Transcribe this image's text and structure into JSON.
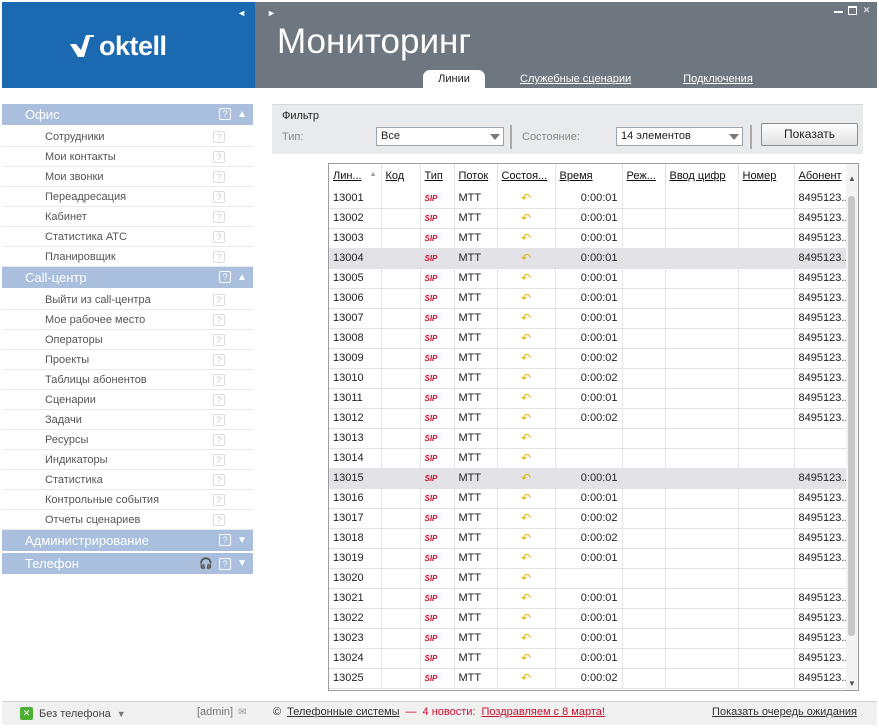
{
  "brand": {
    "name": "oktell"
  },
  "header": {
    "title": "Мониторинг",
    "tabs": [
      {
        "label": "Линии",
        "active": true
      },
      {
        "label": "Служебные сценарии",
        "active": false
      },
      {
        "label": "Подключения",
        "active": false
      }
    ]
  },
  "sidebar": {
    "sections": [
      {
        "label": "Офис",
        "expanded": true,
        "items": [
          "Сотрудники",
          "Мои контакты",
          "Мои звонки",
          "Переадресация",
          "Кабинет",
          "Статистика АТС",
          "Планировщик"
        ]
      },
      {
        "label": "Call-центр",
        "expanded": true,
        "items": [
          "Выйти из call-центра",
          "Мое рабочее место",
          "Операторы",
          "Проекты",
          "Таблицы абонентов",
          "Сценарии",
          "Задачи",
          "Ресурсы",
          "Индикаторы",
          "Статистика",
          "Контрольные события",
          "Отчеты сценариев"
        ]
      },
      {
        "label": "Администрирование",
        "expanded": false,
        "items": []
      },
      {
        "label": "Телефон",
        "expanded": false,
        "items": []
      }
    ]
  },
  "filter": {
    "title": "Фильтр",
    "type_label": "Тип:",
    "type_value": "Все",
    "state_label": "Состояние:",
    "state_value": "14 элементов",
    "show_button": "Показать"
  },
  "table": {
    "columns": [
      "Лин...",
      "Код",
      "Тип",
      "Поток",
      "Состоя...",
      "Время",
      "Реж...",
      "Ввод цифр",
      "Номер",
      "Абонент"
    ],
    "rows": [
      {
        "line": "13001",
        "type": "SIP",
        "stream": "MTT",
        "time": "0:00:01",
        "subscriber": "8495123..."
      },
      {
        "line": "13002",
        "type": "SIP",
        "stream": "MTT",
        "time": "0:00:01",
        "subscriber": "8495123..."
      },
      {
        "line": "13003",
        "type": "SIP",
        "stream": "MTT",
        "time": "0:00:01",
        "subscriber": "8495123..."
      },
      {
        "line": "13004",
        "type": "SIP",
        "stream": "MTT",
        "time": "0:00:01",
        "subscriber": "8495123...",
        "selected": true
      },
      {
        "line": "13005",
        "type": "SIP",
        "stream": "MTT",
        "time": "0:00:01",
        "subscriber": "8495123..."
      },
      {
        "line": "13006",
        "type": "SIP",
        "stream": "MTT",
        "time": "0:00:01",
        "subscriber": "8495123..."
      },
      {
        "line": "13007",
        "type": "SIP",
        "stream": "MTT",
        "time": "0:00:01",
        "subscriber": "8495123..."
      },
      {
        "line": "13008",
        "type": "SIP",
        "stream": "MTT",
        "time": "0:00:01",
        "subscriber": "8495123..."
      },
      {
        "line": "13009",
        "type": "SIP",
        "stream": "MTT",
        "time": "0:00:02",
        "subscriber": "8495123..."
      },
      {
        "line": "13010",
        "type": "SIP",
        "stream": "MTT",
        "time": "0:00:02",
        "subscriber": "8495123..."
      },
      {
        "line": "13011",
        "type": "SIP",
        "stream": "MTT",
        "time": "0:00:01",
        "subscriber": "8495123..."
      },
      {
        "line": "13012",
        "type": "SIP",
        "stream": "MTT",
        "time": "0:00:02",
        "subscriber": "8495123..."
      },
      {
        "line": "13013",
        "type": "SIP",
        "stream": "MTT",
        "time": "",
        "subscriber": ""
      },
      {
        "line": "13014",
        "type": "SIP",
        "stream": "MTT",
        "time": "",
        "subscriber": ""
      },
      {
        "line": "13015",
        "type": "SIP",
        "stream": "MTT",
        "time": "0:00:01",
        "subscriber": "8495123...",
        "selected": true
      },
      {
        "line": "13016",
        "type": "SIP",
        "stream": "MTT",
        "time": "0:00:01",
        "subscriber": "8495123..."
      },
      {
        "line": "13017",
        "type": "SIP",
        "stream": "MTT",
        "time": "0:00:02",
        "subscriber": "8495123..."
      },
      {
        "line": "13018",
        "type": "SIP",
        "stream": "MTT",
        "time": "0:00:02",
        "subscriber": "8495123..."
      },
      {
        "line": "13019",
        "type": "SIP",
        "stream": "MTT",
        "time": "0:00:01",
        "subscriber": "8495123..."
      },
      {
        "line": "13020",
        "type": "SIP",
        "stream": "MTT",
        "time": "",
        "subscriber": ""
      },
      {
        "line": "13021",
        "type": "SIP",
        "stream": "MTT",
        "time": "0:00:01",
        "subscriber": "8495123..."
      },
      {
        "line": "13022",
        "type": "SIP",
        "stream": "MTT",
        "time": "0:00:01",
        "subscriber": "8495123..."
      },
      {
        "line": "13023",
        "type": "SIP",
        "stream": "MTT",
        "time": "0:00:01",
        "subscriber": "8495123..."
      },
      {
        "line": "13024",
        "type": "SIP",
        "stream": "MTT",
        "time": "0:00:01",
        "subscriber": "8495123..."
      },
      {
        "line": "13025",
        "type": "SIP",
        "stream": "MTT",
        "time": "0:00:02",
        "subscriber": "8495123..."
      }
    ]
  },
  "footer": {
    "phone_status": "Без телефона",
    "user": "[admin]",
    "copyright": "©",
    "company": "Телефонные системы",
    "dash": "—",
    "news": "4 новости:",
    "news_link": "Поздравляем с 8 марта!",
    "queue_link": "Показать очередь ожидания"
  },
  "colors": {
    "brand_blue": "#1b69b0",
    "header_gray": "#6e7780",
    "section_blue": "#a9bfdd",
    "sip_red": "#c8102e",
    "state_yellow": "#e2b400"
  }
}
